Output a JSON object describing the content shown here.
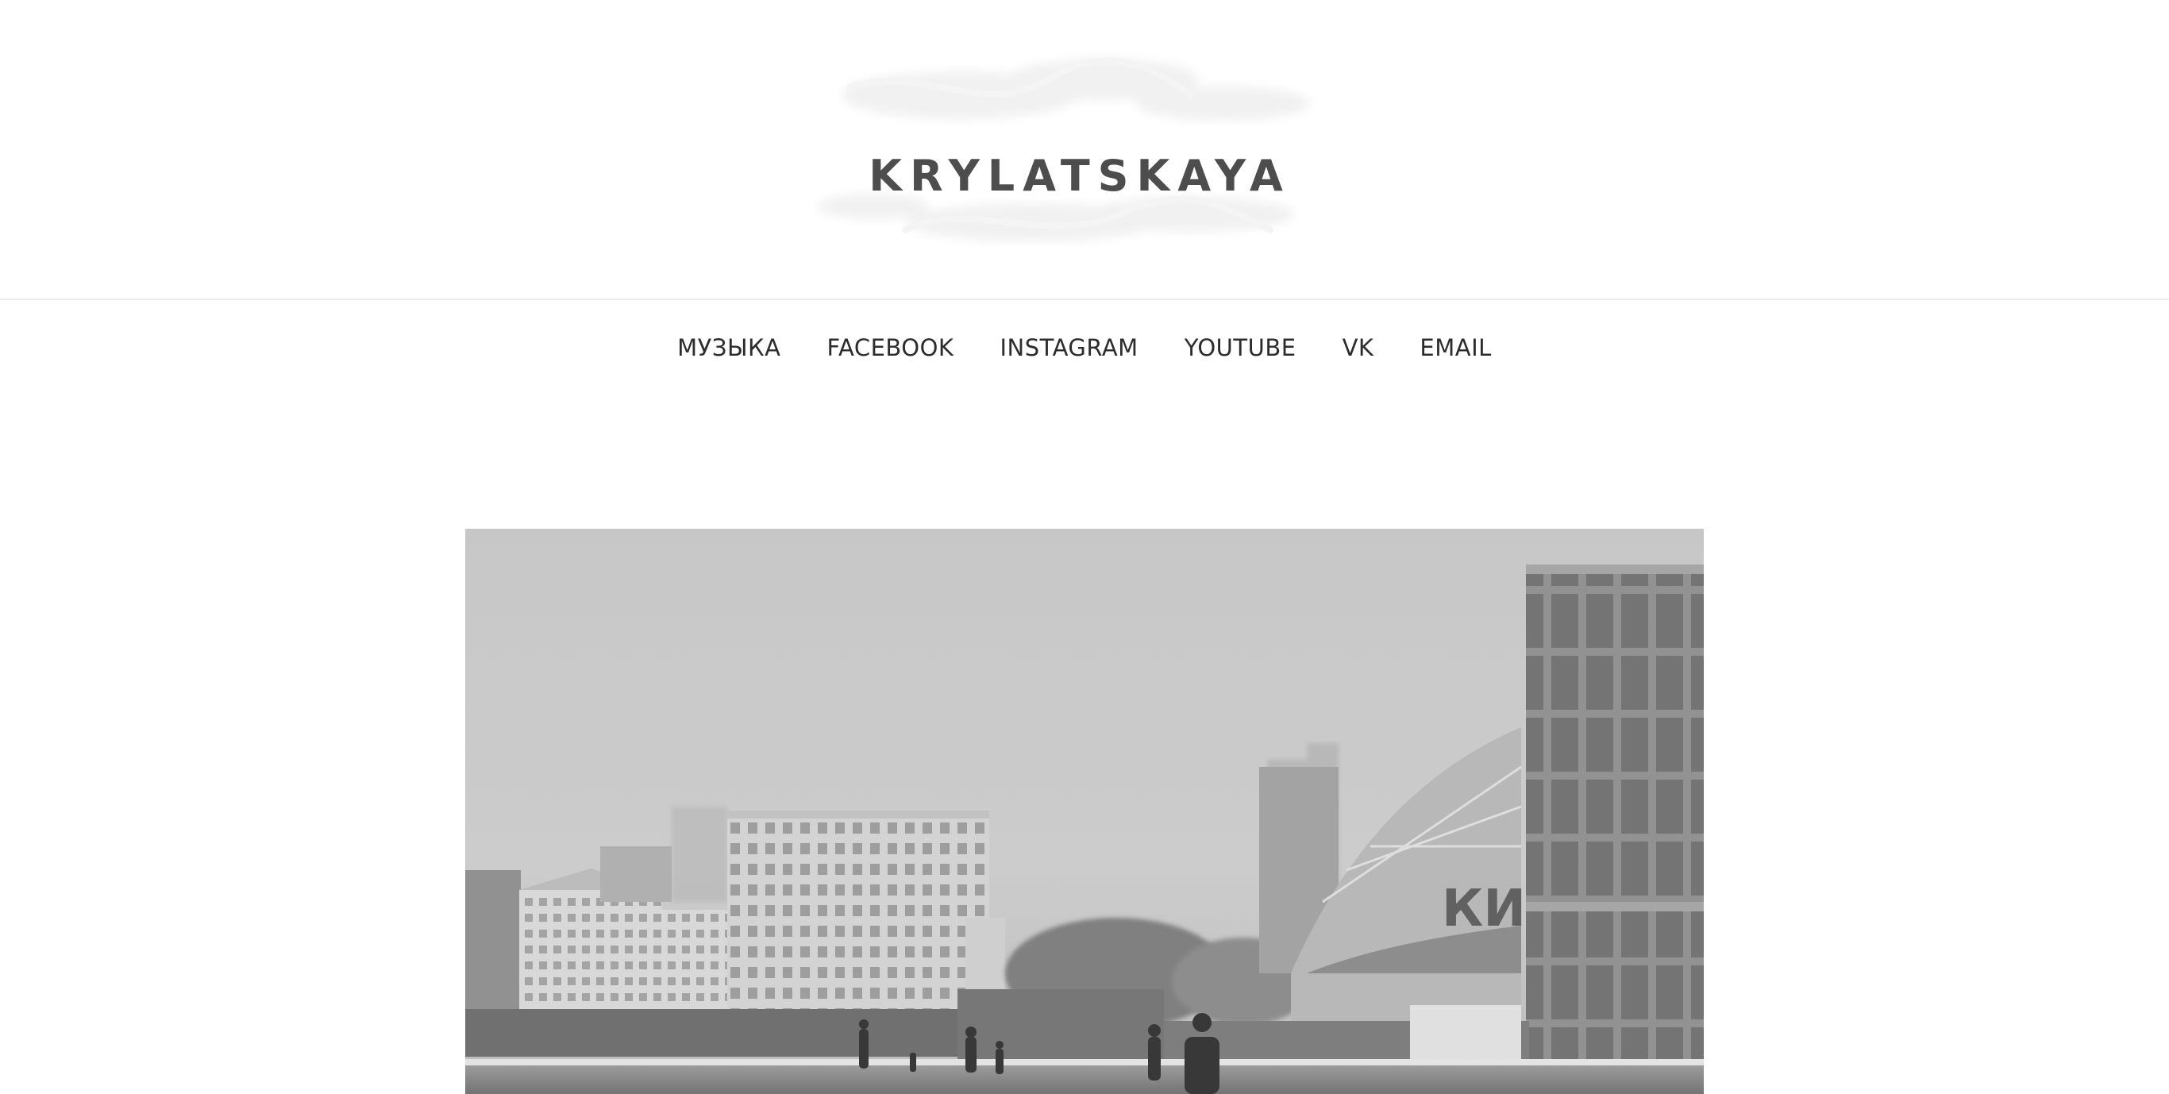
{
  "site": {
    "logo_text": "KRYLATSKAYA"
  },
  "nav": {
    "items": [
      {
        "label": "МУЗЫКА"
      },
      {
        "label": "FACEBOOK"
      },
      {
        "label": "INSTAGRAM"
      },
      {
        "label": "YOUTUBE"
      },
      {
        "label": "VK"
      },
      {
        "label": "EMAIL"
      }
    ]
  },
  "photo": {
    "stadium_letters": "КИЇВ"
  },
  "colors": {
    "background": "#ffffff",
    "text": "#2c2c2c",
    "logo": "#4d4d4d",
    "divider": "#ececec"
  }
}
